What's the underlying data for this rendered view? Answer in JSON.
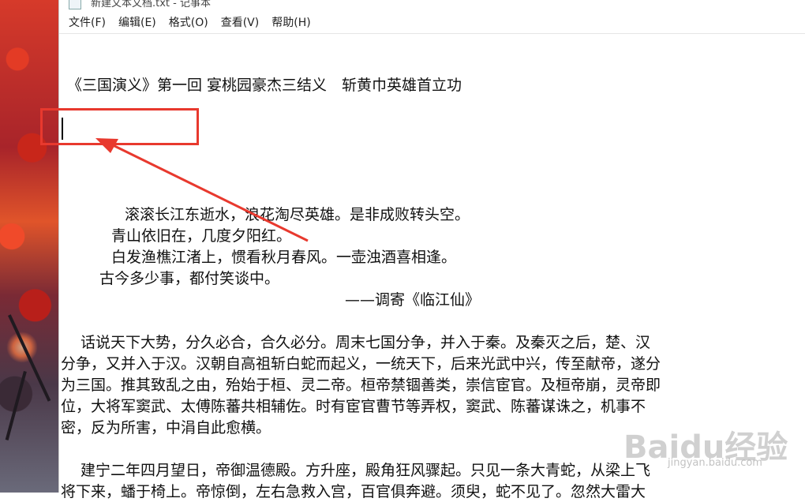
{
  "window": {
    "title": "新建文本文档.txt - 记事本"
  },
  "menu": {
    "items": [
      {
        "label": "文件(F)"
      },
      {
        "label": "编辑(E)"
      },
      {
        "label": "格式(O)"
      },
      {
        "label": "查看(V)"
      },
      {
        "label": "帮助(H)"
      }
    ]
  },
  "document": {
    "title_line": "《三国演义》第一回 宴桃园豪杰三结义　斩黄巾英雄首立功",
    "poem": [
      "滚滚长江东逝水，浪花淘尽英雄。是非成败转头空。",
      "青山依旧在，几度夕阳红。",
      "白发渔樵江渚上，惯看秋月春风。一壶浊酒喜相逢。",
      "古今多少事，都付笑谈中。",
      "——调寄《临江仙》"
    ],
    "paragraph1": [
      "话说天下大势，分久必合，合久必分。周末七国分争，并入于秦。及秦灭之后，楚、汉",
      "分争，又并入于汉。汉朝自高祖斩白蛇而起义，一统天下，后来光武中兴，传至献帝，遂分",
      "为三国。推其致乱之由，殆始于桓、灵二帝。桓帝禁锢善类，崇信宦官。及桓帝崩，灵帝即",
      "位，大将军窦武、太傅陈蕃共相辅佐。时有宦官曹节等弄权，窦武、陈蕃谋诛之，机事不",
      "密，反为所害，中涓自此愈横。"
    ],
    "paragraph2": [
      "建宁二年四月望日，帝御温德殿。方升座，殿角狂风骤起。只见一条大青蛇，从梁上飞",
      "将下来，蟠于椅上。帝惊倒，左右急救入宫，百官俱奔避。须臾，蛇不见了。忽然大雷大"
    ]
  },
  "watermark": {
    "text": "Baidu经验",
    "sub": "jingyan.baidu.com"
  },
  "colors": {
    "annotation": "#e8392e",
    "text": "#111111",
    "background": "#ffffff"
  }
}
